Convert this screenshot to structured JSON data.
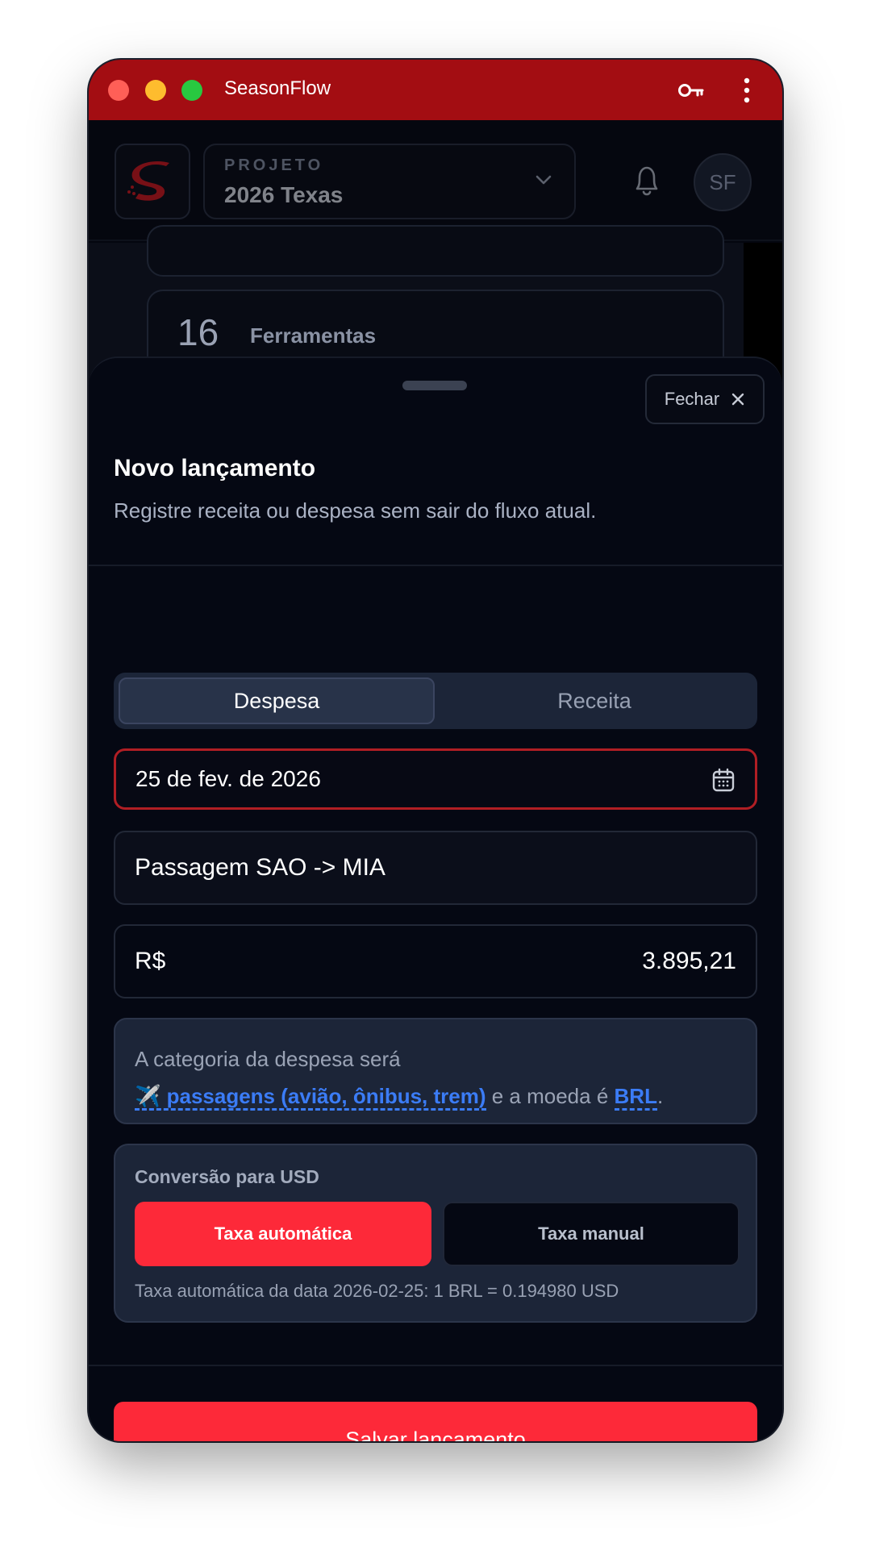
{
  "window": {
    "title": "SeasonFlow"
  },
  "header": {
    "project_label": "PROJETO",
    "project_name": "2026 Texas",
    "avatar_initials": "SF"
  },
  "background_list": {
    "item_number": "16",
    "item_label": "Ferramentas"
  },
  "sheet": {
    "close_label": "Fechar",
    "title": "Novo lançamento",
    "subtitle": "Registre receita ou despesa sem sair do fluxo atual.",
    "tabs": [
      {
        "label": "Despesa",
        "active": true
      },
      {
        "label": "Receita",
        "active": false
      }
    ],
    "date_value": "25 de fev. de 2026",
    "description_value": "Passagem SAO -> MIA",
    "currency_symbol": "R$",
    "amount_value": "3.895,21",
    "info": {
      "prefix": "A categoria da despesa será",
      "category_icon": "✈️",
      "category_link": "passagens (avião, ônibus, trem)",
      "middle": "e a moeda é",
      "currency_link": "BRL",
      "suffix": "."
    },
    "conversion": {
      "title": "Conversão para USD",
      "auto_label": "Taxa automática",
      "manual_label": "Taxa manual",
      "selected": "auto",
      "note": "Taxa automática da data 2026-02-25: 1 BRL = 0.194980 USD"
    },
    "save_label": "Salvar lançamento"
  },
  "colors": {
    "brand_red": "#a30d12",
    "accent_red": "#fd2939",
    "link_blue": "#3b7cf6",
    "background": "#050813"
  }
}
